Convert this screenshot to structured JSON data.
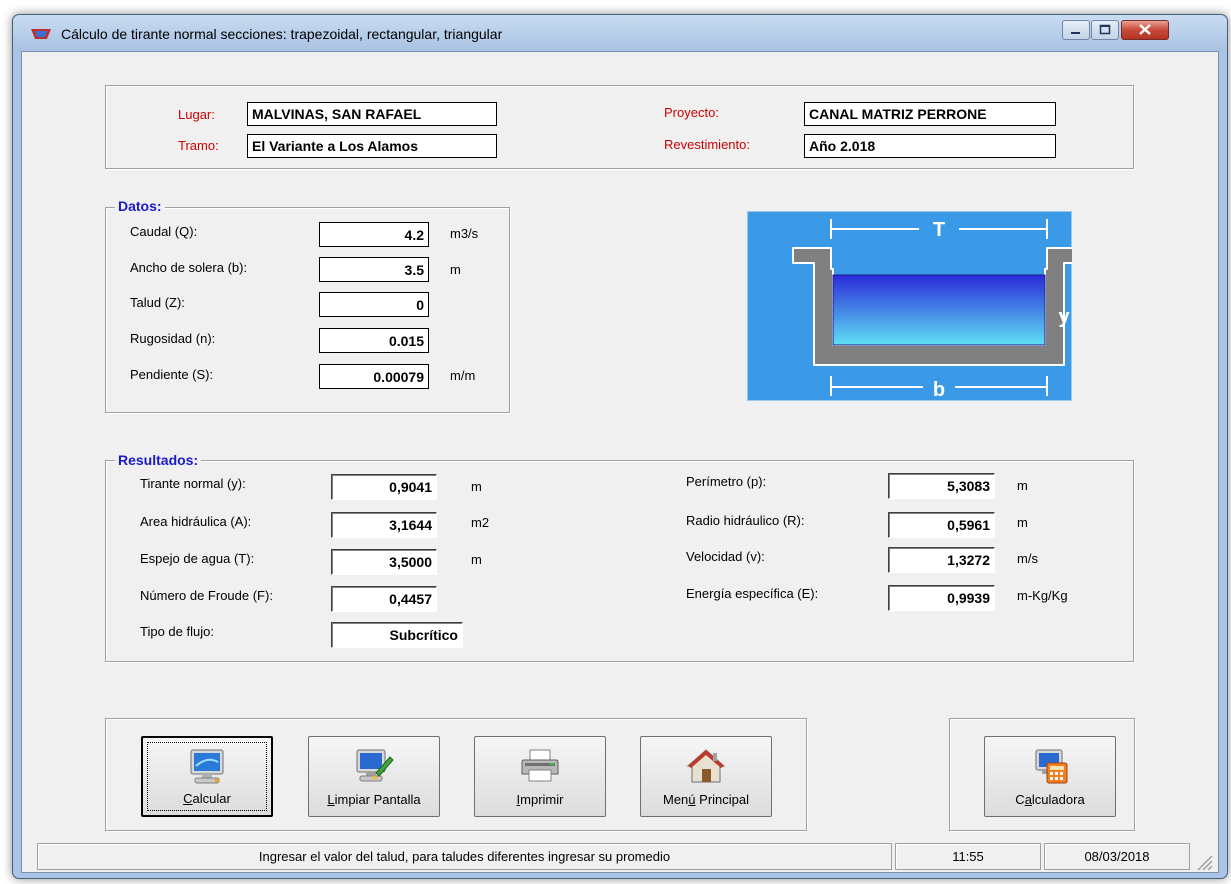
{
  "window": {
    "title": "Cálculo de tirante normal secciones: trapezoidal, rectangular, triangular"
  },
  "header": {
    "lugar_label": "Lugar:",
    "lugar_value": "MALVINAS, SAN RAFAEL",
    "tramo_label": "Tramo:",
    "tramo_value": "El Variante a Los Alamos",
    "proyecto_label": "Proyecto:",
    "proyecto_value": "CANAL MATRIZ PERRONE",
    "revestimiento_label": "Revestimiento:",
    "revestimiento_value": "Año 2.018"
  },
  "datos": {
    "legend": "Datos:",
    "rows": [
      {
        "label": "Caudal (Q):",
        "value": "4.2",
        "unit": "m3/s"
      },
      {
        "label": "Ancho de solera (b):",
        "value": "3.5",
        "unit": "m"
      },
      {
        "label": "Talud (Z):",
        "value": "0",
        "unit": ""
      },
      {
        "label": "Rugosidad (n):",
        "value": "0.015",
        "unit": ""
      },
      {
        "label": "Pendiente (S):",
        "value": "0.00079",
        "unit": "m/m"
      }
    ]
  },
  "diagram": {
    "top_label": "T",
    "side_label": "y",
    "bottom_label": "b",
    "bg_color": "#3a9ae8"
  },
  "resultados": {
    "legend": "Resultados:",
    "left": [
      {
        "label": "Tirante normal (y):",
        "value": "0,9041",
        "unit": "m"
      },
      {
        "label": "Area hidráulica (A):",
        "value": "3,1644",
        "unit": "m2"
      },
      {
        "label": "Espejo de agua (T):",
        "value": "3,5000",
        "unit": "m"
      },
      {
        "label": "Número de Froude (F):",
        "value": "0,4457",
        "unit": ""
      },
      {
        "label": "Tipo de flujo:",
        "value": "Subcrítico",
        "unit": ""
      }
    ],
    "right": [
      {
        "label": "Perímetro (p):",
        "value": "5,3083",
        "unit": "m"
      },
      {
        "label": "Radio hidráulico (R):",
        "value": "0,5961",
        "unit": "m"
      },
      {
        "label": "Velocidad (v):",
        "value": "1,3272",
        "unit": "m/s"
      },
      {
        "label": "Energía específica (E):",
        "value": "0,9939",
        "unit": "m-Kg/Kg"
      }
    ]
  },
  "buttons": {
    "calcular": {
      "u": "C",
      "rest": "alcular",
      "icon": "monitor-icon"
    },
    "limpiar": {
      "u": "L",
      "rest": "impiar Pantalla",
      "icon": "clear-screen-icon"
    },
    "imprimir": {
      "u": "I",
      "rest": "mprimir",
      "icon": "printer-icon"
    },
    "menu": {
      "pre": "Men",
      "u": "ú",
      "rest": " Principal",
      "icon": "home-icon"
    },
    "calculadora": {
      "pre": "C",
      "u": "a",
      "rest": "lculadora",
      "icon": "calculator-icon"
    }
  },
  "statusbar": {
    "message": "Ingresar el valor del talud, para taludes diferentes ingresar su promedio",
    "time": "11:55",
    "date": "08/03/2018"
  }
}
